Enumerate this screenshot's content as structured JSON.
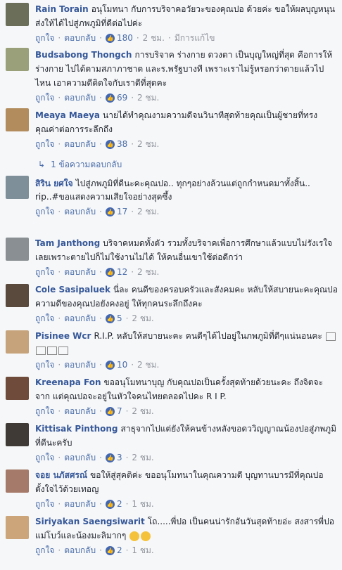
{
  "actions": {
    "like": "ถูกใจ",
    "reply": "ตอบกลับ",
    "edited": "มีการแก้ไข"
  },
  "comments": [
    {
      "name": "Rain Torain",
      "text": "อนุโมทนา กับการบริจาคอวัยวะของคุณปอ ด้วยค่ะ ขอให้ผลบุญหนุนส่งให้ได้ไปสู่ภพภูมิที่ดีต่อไปค่ะ",
      "likes": "180",
      "time": "2 ชม.",
      "avatar_color": "#6b6f5a"
    },
    {
      "name": "Budsabong Thongch",
      "text": "การบริจาค ร่างกาย ดวงตา เป็นบุญใหญ่ที่สุด คือการให้ ร่างกาย ไปได้ตามสภาภาชาต และร.พรัฐบางที เพราะเราไม่รู้หรอกว่าตายแล้วไปไหน เอาความดีติดใจกับเราดีที่สุดคะ",
      "likes": "69",
      "time": "2 ชม.",
      "avatar_color": "#9aa07a"
    },
    {
      "name": "Meaya Maeya",
      "text": "นายได้ทำคุณงามความดีจนวินาทีสุดท้ายคุณเป็นผู้ชายที่ทรงคุณค่าต่อการระลึกถึง",
      "likes": "38",
      "time": "2 ชม.",
      "avatar_color": "#b38c5e"
    },
    {
      "name": "สิริน ยศใจ",
      "text": "ไปสู่ภพภูมิที่ดีนะคะคุณปอ.. ทุกๆอย่างล้วนแต่ถูกกำหนดมาทั้งสิ้น.. rip..#ขอแสดงความเสียใจอย่างสุดซึ้ง",
      "likes": "17",
      "time": "2 ชม.",
      "avatar_color": "#7f8f9a"
    },
    {
      "name": "Tam Janthong",
      "text": "บริจาคหมดทั้งตัว รวมทั้งบริจาคเพื่อการศึกษาแล้วแบบไม่รังเรใจเลยเพราะตายไปก็ไม่ใช้งานไม่ได้ ให้คนอื่นเขาใช้ต่อดีกว่า",
      "likes": "12",
      "time": "2 ชม.",
      "avatar_color": "#8a8f93"
    },
    {
      "name": "Cole Sasipaluek",
      "text": "นี่ละ คนดีของครอบครัวและสังคมคะ หลับให้สบายนะคะคุณปอ ความดีของคุณปอยังคงอยู่ ให้ทุกคนระลึกถึงคะ",
      "likes": "5",
      "time": "2 ชม.",
      "avatar_color": "#5a4a3e"
    },
    {
      "name": "Pisinee Wcr",
      "text": "R.I.P. หลับให้สบายนะคะ คนดีๆได้ไปอยู่ในภพภูมิที่ดีๆแน่นอนคะ",
      "likes": "10",
      "time": "2 ชม.",
      "avatar_color": "#c7a37b"
    },
    {
      "name": "Kreenapa Fon",
      "text": "ขออนุโมทนาบุญ กับคุณปอเป็นครั้งสุดท้ายด้วยนะคะ ถึงจิตจะจาก แต่คุณปอจะอยู่ในหัวใจคนไทยตลอดไปคะ R I P.",
      "likes": "7",
      "time": "2 ชม.",
      "avatar_color": "#6e4b3a"
    },
    {
      "name": "Kittisak Pinthong",
      "text": "สาธุจากไปแต่ยังให้คนข้างหลังขอดววิญญาณน้องปอสู่ภพภูมิที่ดีนะครับ",
      "likes": "3",
      "time": "2 ชม.",
      "avatar_color": "#3f3a36"
    },
    {
      "name": "จอย นภัสศรณ์",
      "text": "ขอให้สู่สุคติค่ะ ขออนุโมทนาในคุณความดี บุญทานบารมีที่คุณปอตั้งใจไว้ด้วยเทอญ",
      "likes": "2",
      "time": "1 ชม.",
      "avatar_color": "#a67a6a"
    },
    {
      "name": "Siriyakan Saengsiwarit",
      "text": "โถ.....พี่ปอ เป็นคนน่ารักอันวันสุดท้ายอ่ะ สงสารพี่ปอ แม่โบว์และน้องมะลิมากๆ",
      "likes": "2",
      "time": "1 ชม.",
      "avatar_color": "#cda57a"
    }
  ],
  "replies_link": "1 ข้อความตอบกลับ"
}
